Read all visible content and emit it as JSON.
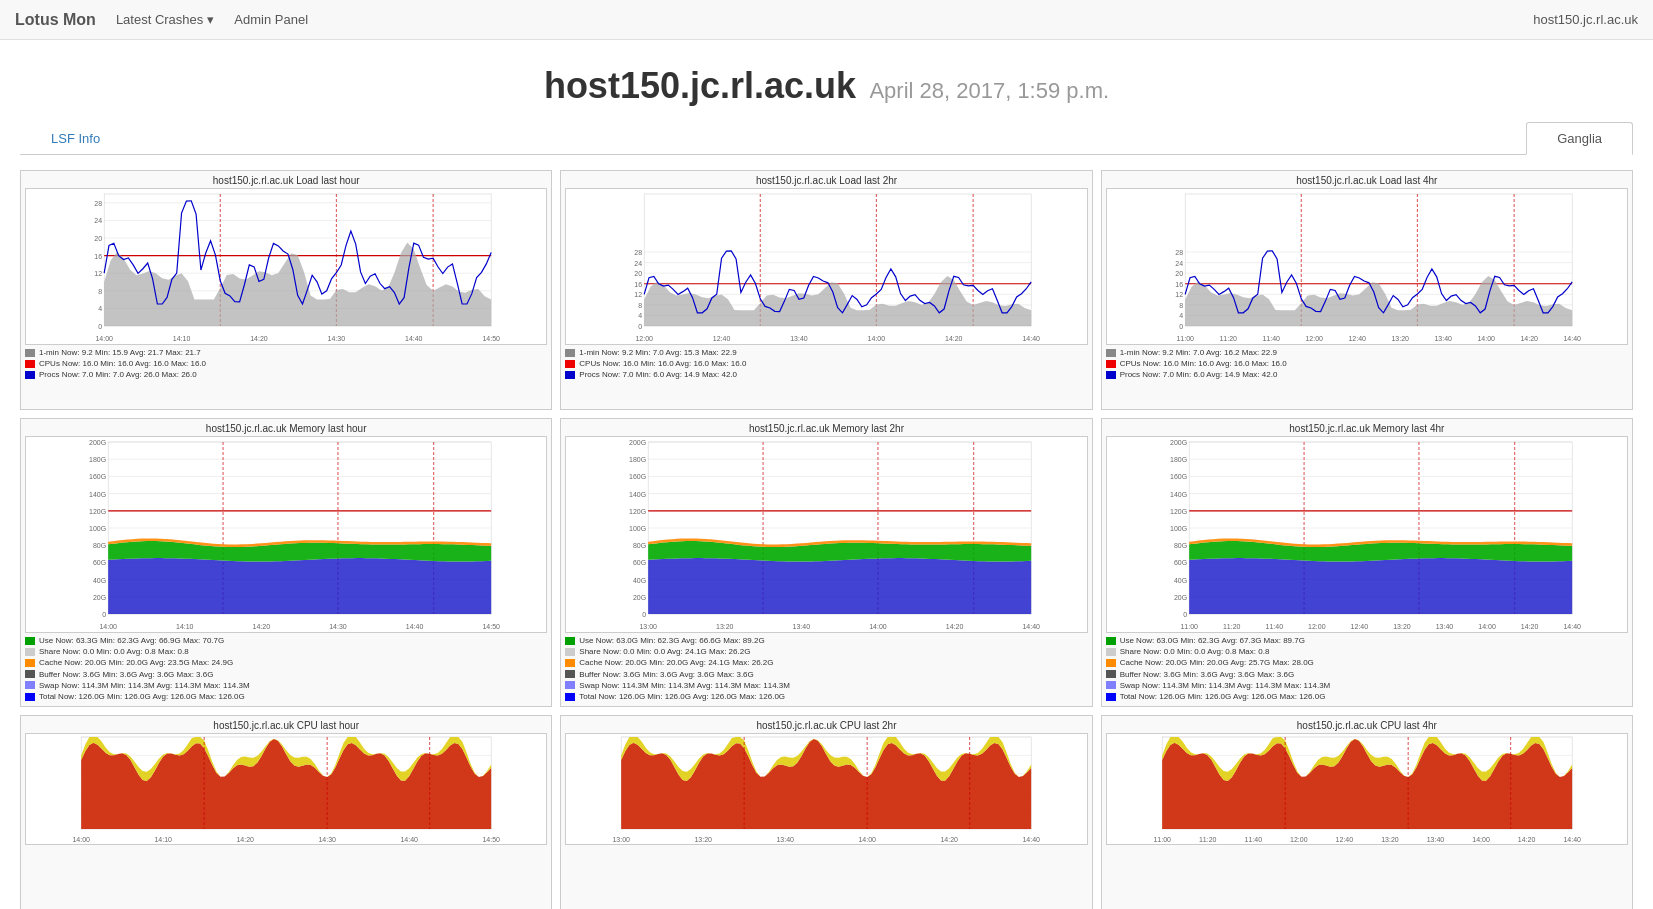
{
  "navbar": {
    "brand": "Lotus Mon",
    "links": [
      {
        "label": "Latest Crashes",
        "has_dropdown": true
      },
      {
        "label": "Admin Panel",
        "has_dropdown": false
      }
    ],
    "hostname": "host150.jc.rl.ac.uk"
  },
  "page_header": {
    "host": "host150.jc.rl.ac.uk",
    "datetime": "April 28, 2017, 1:59 p.m."
  },
  "tabs": [
    {
      "label": "LSF Info",
      "active": false
    },
    {
      "label": "Ganglia",
      "active": true
    }
  ],
  "charts": {
    "rows": [
      {
        "type": "load",
        "cells": [
          {
            "title": "host150.jc.rl.ac.uk Load last hour",
            "legend": [
              {
                "color": "#888",
                "label": "1-min",
                "stats": "Now: 9.2  Min: 15.9  Avg: 21.7  Max: 21.7"
              },
              {
                "color": "#e00",
                "label": "CPUs",
                "stats": "Now: 16.0  Min: 16.0  Avg: 16.0  Max: 16.0"
              },
              {
                "color": "#00c",
                "label": "Procs",
                "stats": "Now: 7.0  Min: 7.0  Avg: 26.0  Max: 26.0"
              }
            ],
            "xLabels": [
              "14:00",
              "14:10",
              "14:20",
              "14:30",
              "14:40",
              "14:50"
            ],
            "yMax": 30
          },
          {
            "title": "host150.jc.rl.ac.uk Load last 2hr",
            "legend": [
              {
                "color": "#888",
                "label": "1-min",
                "stats": "Now: 9.2  Min: 7.0  Avg: 15.3  Max: 22.9"
              },
              {
                "color": "#e00",
                "label": "CPUs",
                "stats": "Now: 16.0  Min: 16.0  Avg: 16.0  Max: 16.0"
              },
              {
                "color": "#00c",
                "label": "Procs",
                "stats": "Now: 7.0  Min: 6.0  Avg: 14.9  Max: 42.0"
              }
            ],
            "xLabels": [
              "12:00",
              "12:40",
              "13:40",
              "14:00",
              "14:20",
              "14:40"
            ],
            "yMax": 50
          },
          {
            "title": "host150.jc.rl.ac.uk Load last 4hr",
            "legend": [
              {
                "color": "#888",
                "label": "1-min",
                "stats": "Now: 9.2  Min: 7.0  Avg: 16.2  Max: 22.9"
              },
              {
                "color": "#e00",
                "label": "CPUs",
                "stats": "Now: 16.0  Min: 16.0  Avg: 16.0  Max: 16.0"
              },
              {
                "color": "#00c",
                "label": "Procs",
                "stats": "Now: 7.0  Min: 6.0  Avg: 14.9  Max: 42.0"
              }
            ],
            "xLabels": [
              "11:00",
              "11:20",
              "11:40",
              "12:00",
              "12:40",
              "13:20",
              "13:40",
              "14:00",
              "14:20",
              "14:40"
            ],
            "yMax": 50
          }
        ]
      },
      {
        "type": "memory",
        "cells": [
          {
            "title": "host150.jc.rl.ac.uk Memory last hour",
            "legend": [
              {
                "color": "#00a000",
                "label": "Use",
                "stats": "Now: 63.3G  Min: 62.3G  Avg: 66.9G  Max: 70.7G"
              },
              {
                "color": "#ccc",
                "label": "Share",
                "stats": "Now: 0.0   Min: 0.0   Avg: 0.8   Max: 0.8"
              },
              {
                "color": "#ff8c00",
                "label": "Cache",
                "stats": "Now: 20.0G  Min: 20.0G  Avg: 23.5G  Max: 24.9G"
              },
              {
                "color": "#555",
                "label": "Buffer",
                "stats": "Now: 3.6G  Min: 3.6G  Avg: 3.6G  Max: 3.6G"
              },
              {
                "color": "#8080ff",
                "label": "Swap",
                "stats": "Now: 114.3M  Min: 114.3M  Avg: 114.3M  Max: 114.3M"
              },
              {
                "color": "#00f",
                "label": "Total",
                "stats": "Now: 126.0G  Min: 126.0G  Avg: 126.0G  Max: 126.0G"
              }
            ],
            "xLabels": [
              "14:00",
              "14:10",
              "14:20",
              "14:30",
              "14:40",
              "14:50"
            ],
            "yMax": 200
          },
          {
            "title": "host150.jc.rl.ac.uk Memory last 2hr",
            "legend": [
              {
                "color": "#00a000",
                "label": "Use",
                "stats": "Now: 63.0G  Min: 62.3G  Avg: 66.6G  Max: 89.2G"
              },
              {
                "color": "#ccc",
                "label": "Share",
                "stats": "Now: 0.0   Min: 0.0   Avg: 24.1G  Max: 26.2G"
              },
              {
                "color": "#ff8c00",
                "label": "Cache",
                "stats": "Now: 20.0G  Min: 20.0G  Avg: 24.1G  Max: 26.2G"
              },
              {
                "color": "#555",
                "label": "Buffer",
                "stats": "Now: 3.6G  Min: 3.6G  Avg: 3.6G  Max: 3.6G"
              },
              {
                "color": "#8080ff",
                "label": "Swap",
                "stats": "Now: 114.3M  Min: 114.3M  Avg: 114.3M  Max: 114.3M"
              },
              {
                "color": "#00f",
                "label": "Total",
                "stats": "Now: 126.0G  Min: 126.0G  Avg: 126.0G  Max: 126.0G"
              }
            ],
            "xLabels": [
              "13:00",
              "13:20",
              "13:40",
              "14:00",
              "14:20",
              "14:40"
            ],
            "yMax": 200
          },
          {
            "title": "host150.jc.rl.ac.uk Memory last 4hr",
            "legend": [
              {
                "color": "#00a000",
                "label": "Use",
                "stats": "Now: 63.0G  Min: 62.3G  Avg: 67.3G  Max: 89.7G"
              },
              {
                "color": "#ccc",
                "label": "Share",
                "stats": "Now: 0.0   Min: 0.0   Avg: 0.8   Max: 0.8"
              },
              {
                "color": "#ff8c00",
                "label": "Cache",
                "stats": "Now: 20.0G  Min: 20.0G  Avg: 25.7G  Max: 28.0G"
              },
              {
                "color": "#555",
                "label": "Buffer",
                "stats": "Now: 3.6G  Min: 3.6G  Avg: 3.6G  Max: 3.6G"
              },
              {
                "color": "#8080ff",
                "label": "Swap",
                "stats": "Now: 114.3M  Min: 114.3M  Avg: 114.3M  Max: 114.3M"
              },
              {
                "color": "#00f",
                "label": "Total",
                "stats": "Now: 126.0G  Min: 126.0G  Avg: 126.0G  Max: 126.0G"
              }
            ],
            "xLabels": [
              "11:00",
              "11:20",
              "11:40",
              "12:00",
              "12:40",
              "13:20",
              "13:40",
              "14:00",
              "14:20",
              "14:40"
            ],
            "yMax": 200
          }
        ]
      },
      {
        "type": "cpu",
        "cells": [
          {
            "title": "host150.jc.rl.ac.uk CPU last hour",
            "xLabels": [
              "14:00",
              "14:10",
              "14:20",
              "14:30",
              "14:40",
              "14:50"
            ],
            "yMax": 100
          },
          {
            "title": "host150.jc.rl.ac.uk CPU last 2hr",
            "xLabels": [
              "13:00",
              "13:20",
              "13:40",
              "14:00",
              "14:20",
              "14:40"
            ],
            "yMax": 100
          },
          {
            "title": "host150.jc.rl.ac.uk CPU last 4hr",
            "xLabels": [
              "11:00",
              "11:20",
              "11:40",
              "12:00",
              "12:40",
              "13:20",
              "13:40",
              "14:00",
              "14:20",
              "14:40"
            ],
            "yMax": 100
          }
        ]
      }
    ]
  },
  "colors": {
    "accent": "#337ab7",
    "navbar_bg": "#f8f8f8",
    "border": "#cccccc"
  }
}
